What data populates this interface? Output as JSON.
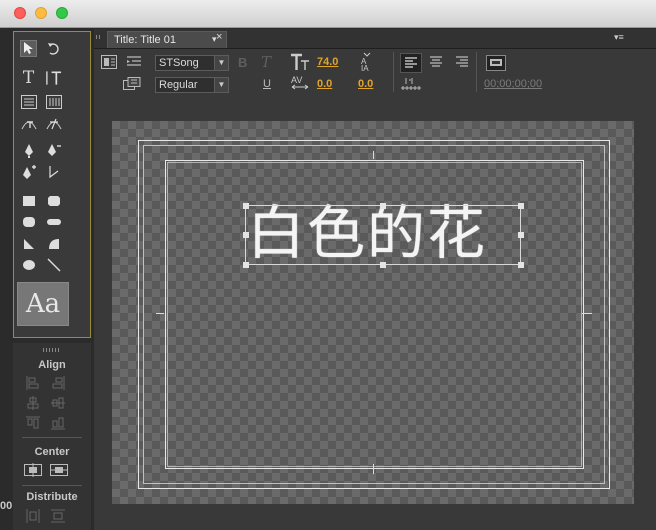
{
  "window": {
    "traffic_lights": [
      "close",
      "minimize",
      "maximize"
    ]
  },
  "tab": {
    "label": "Title: Title 01",
    "close_glyph": "×",
    "menu_glyph": "▾",
    "panel_menu_glyph": "▾≡"
  },
  "properties": {
    "font_family": "STSong",
    "font_style": "Regular",
    "font_size": "74.0",
    "kerning": "0.0",
    "leading": "0.0",
    "timecode": "00;00;00;00",
    "bold_label": "B",
    "italic_label": "T",
    "underline_label": "U"
  },
  "tools_panel": {
    "preview_text": "Aa"
  },
  "align_panel": {
    "align_label": "Align",
    "center_label": "Center",
    "distribute_label": "Distribute",
    "edge_fragment": "00"
  },
  "canvas": {
    "text": "白色的花"
  },
  "colors": {
    "accent_value": "#e0a52a",
    "panel_bg": "#393939",
    "selected_border": "#9b8a3a"
  }
}
